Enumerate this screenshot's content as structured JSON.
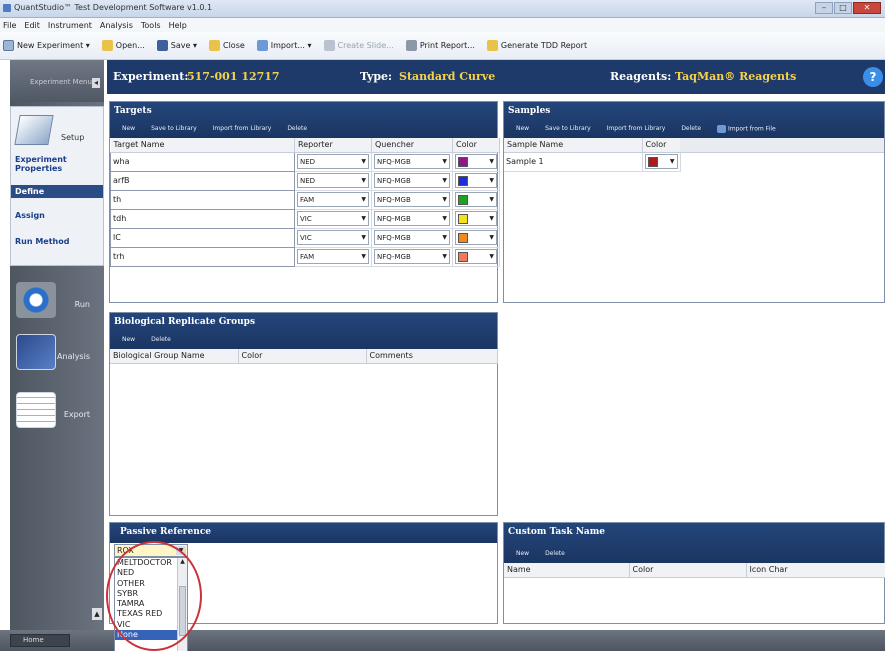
{
  "window": {
    "title": "QuantStudio™ Test Development Software v1.0.1"
  },
  "menu": [
    "File",
    "Edit",
    "Instrument",
    "Analysis",
    "Tools",
    "Help"
  ],
  "toolbar": {
    "new_experiment": "New Experiment ▾",
    "open": "Open...",
    "save": "Save ▾",
    "close": "Close",
    "import": "Import... ▾",
    "create_slide": "Create Slide...",
    "print_report": "Print Report...",
    "generate_tdd": "Generate TDD Report"
  },
  "sidebar": {
    "experiment_menu": "Experiment Menu",
    "setup_label": "Setup",
    "links": [
      "Experiment Properties",
      "Define",
      "Assign",
      "Run Method"
    ],
    "active_link": "Define",
    "run": "Run",
    "analysis": "Analysis",
    "export": "Export",
    "home": "Home"
  },
  "header": {
    "experiment_label": "Experiment:",
    "experiment_value": "517-001 12717",
    "type_label": "Type:",
    "type_value": "Standard Curve",
    "reagents_label": "Reagents:",
    "reagents_value": "TaqMan® Reagents",
    "help": "?"
  },
  "targets": {
    "title": "Targets",
    "actions": [
      "New",
      "Save to Library",
      "Import from Library",
      "Delete"
    ],
    "columns": [
      "Target Name",
      "Reporter",
      "Quencher",
      "Color"
    ],
    "rows": [
      {
        "name": "wha",
        "reporter": "NED",
        "quencher": "NFQ-MGB",
        "color": "#8b1a8b"
      },
      {
        "name": "arfB",
        "reporter": "NED",
        "quencher": "NFQ-MGB",
        "color": "#1c2fd6"
      },
      {
        "name": "th",
        "reporter": "FAM",
        "quencher": "NFQ-MGB",
        "color": "#1fa01f"
      },
      {
        "name": "tdh",
        "reporter": "VIC",
        "quencher": "NFQ-MGB",
        "color": "#f2e21a"
      },
      {
        "name": "lC",
        "reporter": "VIC",
        "quencher": "NFQ-MGB",
        "color": "#f08a1c"
      },
      {
        "name": "trh",
        "reporter": "FAM",
        "quencher": "NFQ-MGB",
        "color": "#f07a5a"
      }
    ]
  },
  "samples": {
    "title": "Samples",
    "actions": [
      "New",
      "Save to Library",
      "Import from Library",
      "Delete",
      "Import from File"
    ],
    "columns": [
      "Sample Name",
      "Color"
    ],
    "rows": [
      {
        "name": "Sample 1",
        "color": "#b01a1a"
      }
    ]
  },
  "bio_groups": {
    "title": "Biological Replicate Groups",
    "actions": [
      "New",
      "Delete"
    ],
    "columns": [
      "Biological Group Name",
      "Color",
      "Comments"
    ]
  },
  "passive_reference": {
    "title": "Passive Reference",
    "selected": "ROX",
    "options": [
      "MELTDOCTOR",
      "NED",
      "OTHER",
      "SYBR",
      "TAMRA",
      "TEXAS RED",
      "VIC",
      "None"
    ],
    "highlighted": "None"
  },
  "custom_task": {
    "title": "Custom Task Name",
    "actions": [
      "New",
      "Delete"
    ],
    "columns": [
      "Name",
      "Color",
      "Icon Char"
    ]
  }
}
